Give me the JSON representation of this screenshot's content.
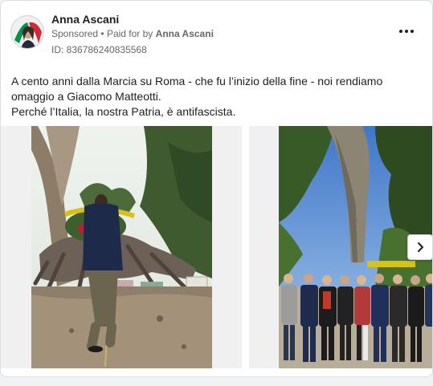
{
  "post": {
    "author": "Anna Ascani",
    "sponsored_label": "Sponsored",
    "separator": "•",
    "paid_for_prefix": "Paid for by",
    "paid_for_name": "Anna Ascani",
    "ad_id": "ID: 836786240835568",
    "more_icon": "more-horizontal-icon",
    "text_lines": [
      "A cento anni dalla Marcia su Roma - che fu l’inizio della fine - noi rendiamo omaggio a Giacomo Matteotti.",
      "Perché l’Italia, la nostra Patria, è antifascista."
    ]
  },
  "carousel": {
    "next_icon": "chevron-right-icon",
    "slides": [
      {
        "subject": "monument-wreath-photo"
      },
      {
        "subject": "group-photo"
      }
    ]
  },
  "colors": {
    "background": "#f0f2f5",
    "card": "#ffffff",
    "text_primary": "#1c1e21",
    "text_secondary": "#65676b",
    "flag_green": "#009246",
    "flag_red": "#ce2b37"
  }
}
